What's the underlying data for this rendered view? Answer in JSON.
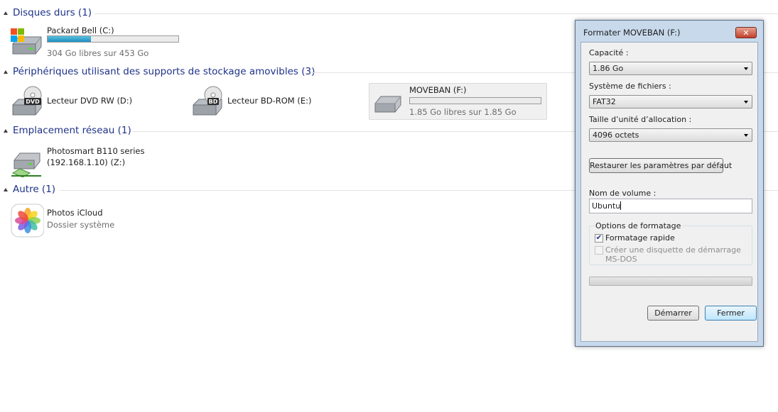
{
  "groups": {
    "hard_disks": {
      "title": "Disques durs (1)"
    },
    "removable": {
      "title": "Périphériques utilisant des supports de stockage amovibles (3)"
    },
    "network": {
      "title": "Emplacement réseau (1)"
    },
    "other": {
      "title": "Autre (1)"
    }
  },
  "drives": {
    "c": {
      "name": "Packard Bell (C:)",
      "free": "304 Go libres sur 453 Go",
      "used_fraction": 0.33,
      "icon": "windows-hard-drive-icon"
    },
    "d": {
      "name": "Lecteur DVD RW (D:)",
      "icon": "dvd-drive-icon",
      "badge": "DVD"
    },
    "e": {
      "name": "Lecteur BD-ROM (E:)",
      "icon": "bd-drive-icon",
      "badge": "BD"
    },
    "f": {
      "name": "MOVEBAN (F:)",
      "free": "1.85 Go libres sur 1.85 Go",
      "used_fraction": 0.0,
      "icon": "removable-drive-icon"
    },
    "z": {
      "name_line1": "Photosmart B110 series",
      "name_line2": "(192.168.1.10) (Z:)",
      "icon": "network-drive-icon"
    },
    "icloud": {
      "name": "Photos iCloud",
      "sub": "Dossier système",
      "icon": "icloud-photos-icon"
    }
  },
  "dialog": {
    "title": "Formater MOVEBAN (F:)",
    "close_label": "✕",
    "capacity_label": "Capacité :",
    "capacity_value": "1.86 Go",
    "filesystem_label": "Système de fichiers :",
    "filesystem_value": "FAT32",
    "allocation_label": "Taille d’unité d’allocation :",
    "allocation_value": "4096 octets",
    "restore_label": "Restaurer les paramètres par défaut",
    "volume_label": "Nom de volume :",
    "volume_value": "Ubuntu",
    "options_legend": "Options de formatage",
    "quick_format_label": "Formatage rapide",
    "quick_format_checked": true,
    "msdos_line1": "Créer une disquette de démarrage",
    "msdos_line2": "MS-DOS",
    "msdos_checked": false,
    "progress": 0,
    "start_label": "Démarrer",
    "close_button_label": "Fermer"
  },
  "colors": {
    "group_title": "#1e3287",
    "dialog_frame": "#c8d9ec",
    "progress_fill": "#1d8fc1",
    "close_button": "#c2412b"
  }
}
